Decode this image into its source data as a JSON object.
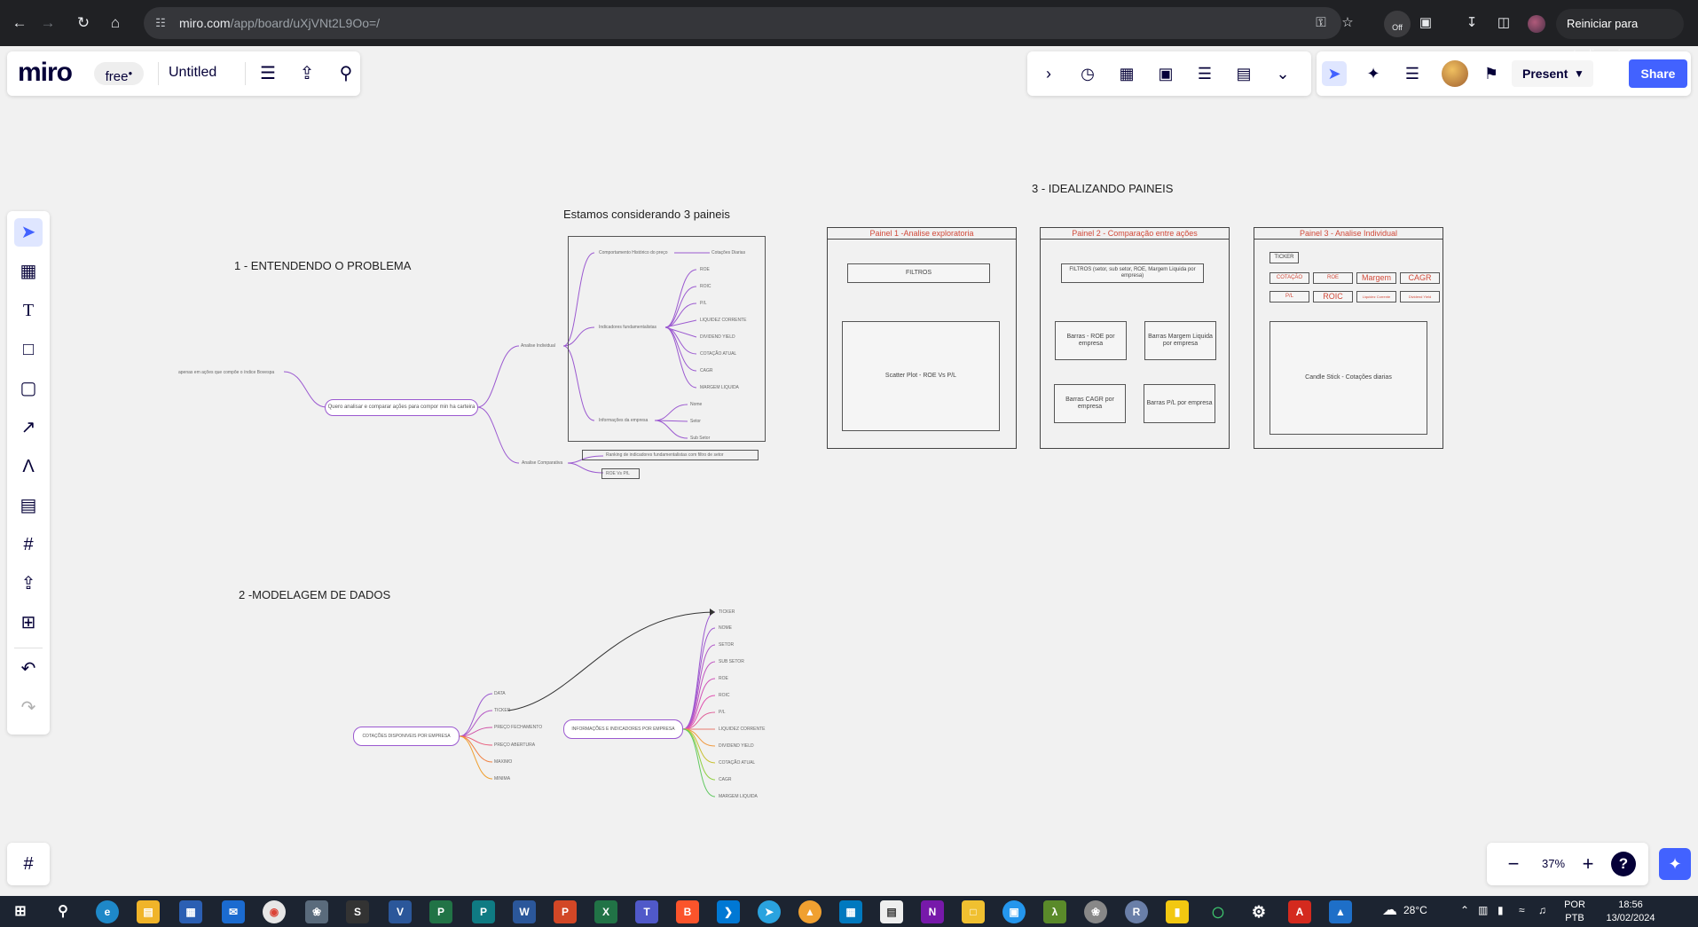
{
  "browser": {
    "url_host": "miro.com",
    "url_path": "/app/board/uXjVNt2L9Oo=/",
    "extension_badge": "Off",
    "update_button": "Reiniciar para atualizar"
  },
  "miro": {
    "logo": "miro",
    "plan": "free",
    "board_title": "Untitled",
    "present_label": "Present",
    "share_label": "Share",
    "zoom": "37%",
    "help": "?"
  },
  "canvas": {
    "section1_title": "1 - ENTENDENDO O PROBLEMA",
    "section2_title": "2 -MODELAGEM DE DADOS",
    "section3_title": "3 - IDEALIZANDO PAINEIS",
    "panels_caption": "Estamos considerando 3 paineis",
    "mindmap1": {
      "root": "Quero analisar e comparar ações para compor min ha carteira",
      "left_note": "apenas em ações que compõe o índice Bovespa",
      "branch_individual": "Analise Individual",
      "branch_comparativa": "Analise Comparativa",
      "sub_hist": "Comportamento Histórico do preço",
      "sub_hist_leaf": "Cotações Diarias",
      "sub_fund": "Indicadores fundamentalistas",
      "sub_fund_leaves": [
        "ROE",
        "ROIC",
        "P/L",
        "LIQUIDEZ CORRENTE",
        "DIVIDEND YIELD",
        "COTAÇÃO ATUAL",
        "CAGR",
        "MARGEM LIQUIDA"
      ],
      "sub_info": "Informações da empresa",
      "sub_info_leaves": [
        "Nome",
        "Setor",
        "Sub Setor"
      ],
      "comp_ranking": "Ranking de indicadores fundamentalistas com filtro de setor",
      "comp_scatter": "ROE Vs P/L"
    },
    "mindmap2": {
      "root_left": "COTAÇÕES DISPONIVEIS POR EMPRESA",
      "left_leaves": [
        "DATA",
        "TICKER",
        "PREÇO FECHAMENTO",
        "PREÇO ABERTURA",
        "MAXIMO",
        "MINIMA"
      ],
      "root_right": "INFORMAÇÕES E INDICADORES POR EMPRESA",
      "right_leaves": [
        "TICKER",
        "NOME",
        "SETOR",
        "SUB SETOR",
        "ROE",
        "ROIC",
        "P/L",
        "LIQUIDEZ CORRENTE",
        "DIVIDEND YIELD",
        "COTAÇÃO ATUAL",
        "CAGR",
        "MARGEM LIQUIDA"
      ]
    },
    "panel1": {
      "title": "Painel 1 -Analise exploratoria",
      "filters": "FILTROS",
      "chart": "Scatter Plot - ROE Vs P/L"
    },
    "panel2": {
      "title": "Painel 2 - Comparação entre ações",
      "filters": "FILTROS (setor, sub setor, ROE, Margem Liquida por empresa)",
      "chart_roe": "Barras - ROE por empresa",
      "chart_margem": "Barras Margem Liquida por empresa",
      "chart_cagr": "Barras CAGR por empresa",
      "chart_pl": "Barras P/L por empresa"
    },
    "panel3": {
      "title": "Painel 3 - Analise Individual",
      "ticker": "TICKER",
      "chips_row1": [
        "COTAÇÃO",
        "ROE",
        "Margem",
        "CAGR"
      ],
      "chips_row2": [
        "P/L",
        "ROIC",
        "Liquidez Corrente",
        "Dividend Yield"
      ],
      "chart": "Candle Stick - Cotações diarias"
    }
  },
  "taskbar": {
    "weather": "28°C",
    "lang_line1": "POR",
    "lang_line2": "PTB",
    "time": "18:56",
    "date": "13/02/2024"
  },
  "colors": {
    "accent": "#4262ff",
    "mindmap_purple": "#9b59d0",
    "panel_red": "#d14a3a"
  }
}
